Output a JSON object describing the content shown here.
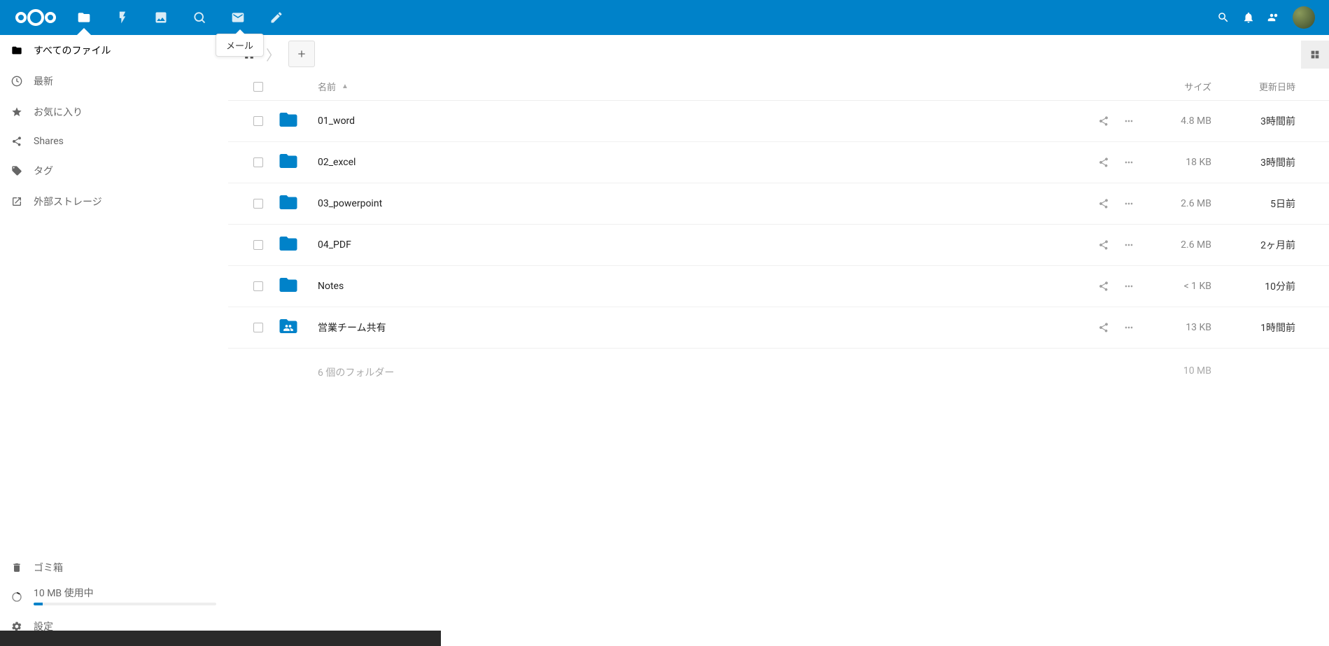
{
  "tooltip": "メール",
  "sidebar": {
    "items": [
      {
        "label": "すべてのファイル",
        "icon": "folder"
      },
      {
        "label": "最新",
        "icon": "clock"
      },
      {
        "label": "お気に入り",
        "icon": "star"
      },
      {
        "label": "Shares",
        "icon": "share"
      },
      {
        "label": "タグ",
        "icon": "tag"
      },
      {
        "label": "外部ストレージ",
        "icon": "external"
      }
    ],
    "trash": "ゴミ箱",
    "quota": "10 MB 使用中",
    "settings": "設定"
  },
  "table": {
    "headers": {
      "name": "名前",
      "size": "サイズ",
      "modified": "更新日時"
    },
    "rows": [
      {
        "name": "01_word",
        "size": "4.8 MB",
        "modified": "3時間前",
        "type": "folder"
      },
      {
        "name": "02_excel",
        "size": "18 KB",
        "modified": "3時間前",
        "type": "folder"
      },
      {
        "name": "03_powerpoint",
        "size": "2.6 MB",
        "modified": "5日前",
        "type": "folder"
      },
      {
        "name": "04_PDF",
        "size": "2.6 MB",
        "modified": "2ヶ月前",
        "type": "folder"
      },
      {
        "name": "Notes",
        "size": "< 1 KB",
        "modified": "10分前",
        "type": "folder"
      },
      {
        "name": "営業チーム共有",
        "size": "13 KB",
        "modified": "1時間前",
        "type": "shared-folder"
      }
    ],
    "summary": {
      "folders": "6 個のフォルダー",
      "size": "10 MB"
    }
  }
}
